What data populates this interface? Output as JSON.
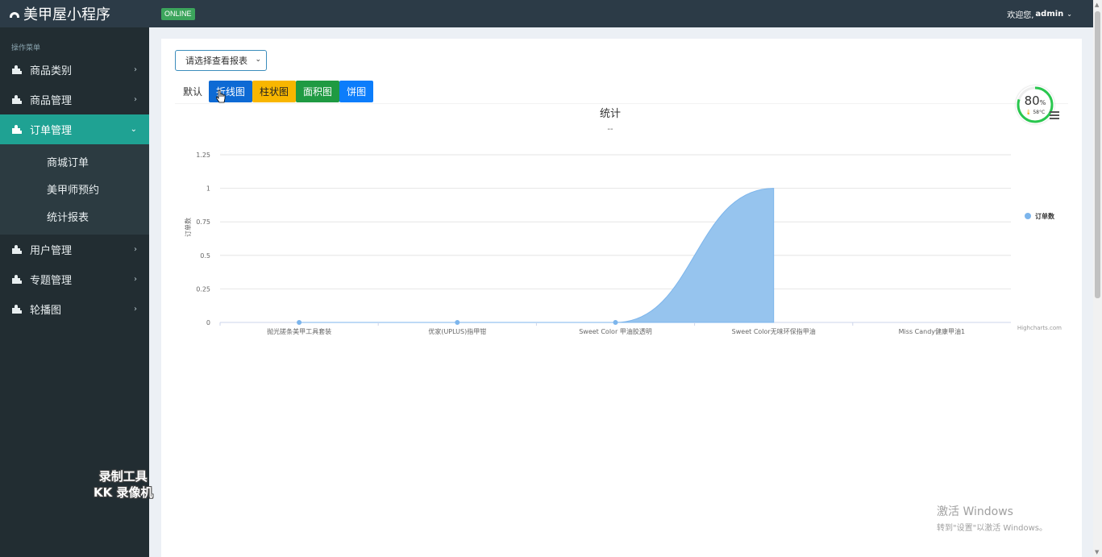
{
  "app": {
    "title": "美甲屋小程序",
    "status": "ONLINE",
    "welcome": "欢迎您,",
    "user": "admin"
  },
  "sidebar": {
    "header": "操作菜单",
    "items": [
      {
        "label": "商品类别"
      },
      {
        "label": "商品管理"
      },
      {
        "label": "订单管理",
        "active": true,
        "children": [
          "商城订单",
          "美甲师预约",
          "统计报表"
        ]
      },
      {
        "label": "用户管理"
      },
      {
        "label": "专题管理"
      },
      {
        "label": "轮播图"
      }
    ]
  },
  "toolbar": {
    "select_value": "请选择查看报表",
    "buttons": [
      "默认",
      "折线图",
      "柱状图",
      "面积图",
      "饼图"
    ]
  },
  "chart_data": {
    "type": "area",
    "title": "统计",
    "subtitle": "--",
    "ylabel": "订单数",
    "categories": [
      "抛光搓条美甲工具套装",
      "优家(UPLUS)指甲钳",
      "Sweet Color 甲油胶透明",
      "Sweet Color无味环保指甲油",
      "Miss Candy健康甲油1"
    ],
    "series": [
      {
        "name": "订单数",
        "values": [
          0,
          0,
          0,
          1,
          null
        ]
      }
    ],
    "ylim": [
      0,
      1.25
    ],
    "yticks": [
      "0",
      "0.25",
      "0.5",
      "0.75",
      "1",
      "1.25"
    ],
    "legend": "right",
    "grid": true,
    "credit": "Highcharts.com",
    "color": "#7cb5ec"
  },
  "widget": {
    "percent": "80",
    "unit": "%",
    "temp": "58°C"
  },
  "watermark": {
    "line1": "录制工具",
    "line2": "KK 录像机"
  },
  "windows": {
    "line1": "激活 Windows",
    "line2": "转到\"设置\"以激活 Windows。"
  }
}
